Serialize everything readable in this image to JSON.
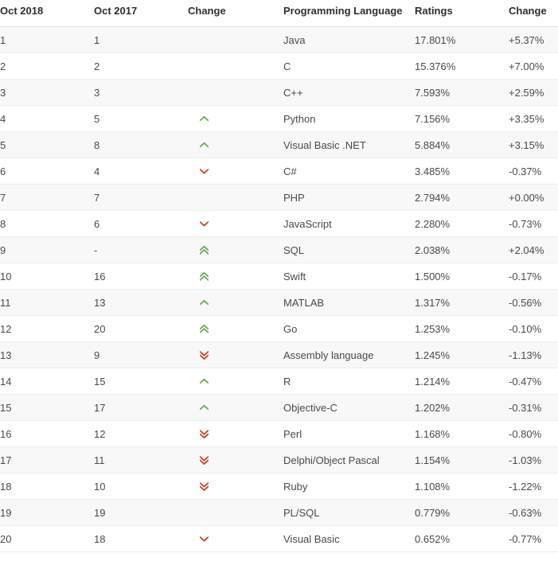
{
  "table": {
    "columns": [
      {
        "key": "rank_new",
        "label": "Oct 2018"
      },
      {
        "key": "rank_old",
        "label": "Oct 2017"
      },
      {
        "key": "change_ico",
        "label": "Change"
      },
      {
        "key": "language",
        "label": "Programming Language"
      },
      {
        "key": "ratings",
        "label": "Ratings"
      },
      {
        "key": "change_val",
        "label": "Change"
      }
    ],
    "colors": {
      "row_odd_background": "#f8f8f9",
      "row_even_background": "#ffffff",
      "row_border": "#eceded",
      "header_border": "#e4e4e4",
      "header_text": "#2f2f2f",
      "cell_text": "#4a4a4a",
      "arrow_up": "#6aa84f",
      "arrow_down": "#cc4125"
    },
    "rows": [
      {
        "rank_new": "1",
        "rank_old": "1",
        "change_ico": "none",
        "language": "Java",
        "ratings": "17.801%",
        "change_val": "+5.37%"
      },
      {
        "rank_new": "2",
        "rank_old": "2",
        "change_ico": "none",
        "language": "C",
        "ratings": "15.376%",
        "change_val": "+7.00%"
      },
      {
        "rank_new": "3",
        "rank_old": "3",
        "change_ico": "none",
        "language": "C++",
        "ratings": "7.593%",
        "change_val": "+2.59%"
      },
      {
        "rank_new": "4",
        "rank_old": "5",
        "change_ico": "up",
        "language": "Python",
        "ratings": "7.156%",
        "change_val": "+3.35%"
      },
      {
        "rank_new": "5",
        "rank_old": "8",
        "change_ico": "up",
        "language": "Visual Basic .NET",
        "ratings": "5.884%",
        "change_val": "+3.15%"
      },
      {
        "rank_new": "6",
        "rank_old": "4",
        "change_ico": "down",
        "language": "C#",
        "ratings": "3.485%",
        "change_val": "-0.37%"
      },
      {
        "rank_new": "7",
        "rank_old": "7",
        "change_ico": "none",
        "language": "PHP",
        "ratings": "2.794%",
        "change_val": "+0.00%"
      },
      {
        "rank_new": "8",
        "rank_old": "6",
        "change_ico": "down",
        "language": "JavaScript",
        "ratings": "2.280%",
        "change_val": "-0.73%"
      },
      {
        "rank_new": "9",
        "rank_old": "-",
        "change_ico": "double-up",
        "language": "SQL",
        "ratings": "2.038%",
        "change_val": "+2.04%"
      },
      {
        "rank_new": "10",
        "rank_old": "16",
        "change_ico": "double-up",
        "language": "Swift",
        "ratings": "1.500%",
        "change_val": "-0.17%"
      },
      {
        "rank_new": "11",
        "rank_old": "13",
        "change_ico": "up",
        "language": "MATLAB",
        "ratings": "1.317%",
        "change_val": "-0.56%"
      },
      {
        "rank_new": "12",
        "rank_old": "20",
        "change_ico": "double-up",
        "language": "Go",
        "ratings": "1.253%",
        "change_val": "-0.10%"
      },
      {
        "rank_new": "13",
        "rank_old": "9",
        "change_ico": "double-down",
        "language": "Assembly language",
        "ratings": "1.245%",
        "change_val": "-1.13%"
      },
      {
        "rank_new": "14",
        "rank_old": "15",
        "change_ico": "up",
        "language": "R",
        "ratings": "1.214%",
        "change_val": "-0.47%"
      },
      {
        "rank_new": "15",
        "rank_old": "17",
        "change_ico": "up",
        "language": "Objective-C",
        "ratings": "1.202%",
        "change_val": "-0.31%"
      },
      {
        "rank_new": "16",
        "rank_old": "12",
        "change_ico": "double-down",
        "language": "Perl",
        "ratings": "1.168%",
        "change_val": "-0.80%"
      },
      {
        "rank_new": "17",
        "rank_old": "11",
        "change_ico": "double-down",
        "language": "Delphi/Object Pascal",
        "ratings": "1.154%",
        "change_val": "-1.03%"
      },
      {
        "rank_new": "18",
        "rank_old": "10",
        "change_ico": "double-down",
        "language": "Ruby",
        "ratings": "1.108%",
        "change_val": "-1.22%"
      },
      {
        "rank_new": "19",
        "rank_old": "19",
        "change_ico": "none",
        "language": "PL/SQL",
        "ratings": "0.779%",
        "change_val": "-0.63%"
      },
      {
        "rank_new": "20",
        "rank_old": "18",
        "change_ico": "down",
        "language": "Visual Basic",
        "ratings": "0.652%",
        "change_val": "-0.77%"
      }
    ]
  }
}
